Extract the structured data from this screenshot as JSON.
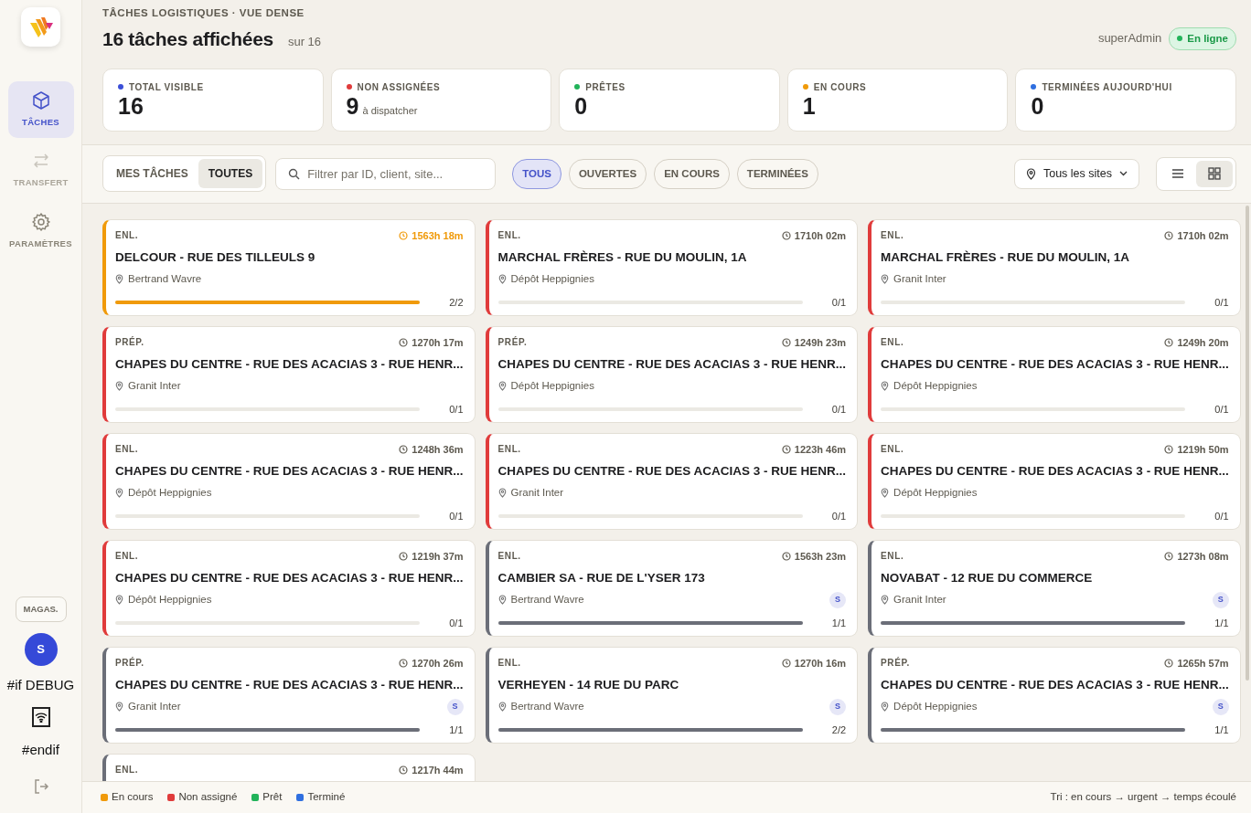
{
  "sidebar": {
    "items": [
      {
        "label": "TÂCHES",
        "selected": true,
        "disabled": false
      },
      {
        "label": "TRANSFERT",
        "selected": false,
        "disabled": true
      },
      {
        "label": "PARAMÈTRES",
        "selected": false,
        "disabled": false
      }
    ],
    "role_button": "MAGAS.",
    "avatar": "S",
    "debug_start": "#if DEBUG",
    "debug_end": "#endif"
  },
  "header": {
    "eyebrow": "TÂCHES LOGISTIQUES · VUE DENSE",
    "title": "16 tâches affichées",
    "subtitle": "sur 16",
    "user": "superAdmin",
    "status": "En ligne"
  },
  "stats": [
    {
      "label": "TOTAL VISIBLE",
      "value": "16",
      "color": "#3b4fd8"
    },
    {
      "label": "NON ASSIGNÉES",
      "value": "9",
      "note": "à dispatcher",
      "color": "#e03b3b"
    },
    {
      "label": "PRÊTES",
      "value": "0",
      "color": "#22b35a"
    },
    {
      "label": "EN COURS",
      "value": "1",
      "color": "#f09a0a"
    },
    {
      "label": "TERMINÉES AUJOURD'HUI",
      "value": "0",
      "color": "#2f6fe0"
    }
  ],
  "scope_tabs": [
    {
      "label": "MES TÂCHES",
      "selected": false
    },
    {
      "label": "TOUTES",
      "selected": true
    }
  ],
  "search": {
    "placeholder": "Filtrer par ID, client, site..."
  },
  "filters": [
    {
      "label": "TOUS",
      "selected": true
    },
    {
      "label": "OUVERTES",
      "selected": false
    },
    {
      "label": "EN COURS",
      "selected": false
    },
    {
      "label": "TERMINÉES",
      "selected": false
    }
  ],
  "site_select": "Tous les sites",
  "views": [
    {
      "selected": false
    },
    {
      "selected": true
    }
  ],
  "tasks": [
    {
      "type": "ENL.",
      "time": "1563h 18m",
      "title": "DELCOUR - RUE DES TILLEULS 9",
      "site": "Bertrand Wavre",
      "progress": "2/2",
      "level": 1,
      "kind": "active"
    },
    {
      "type": "ENL.",
      "time": "1710h 02m",
      "title": "MARCHAL FRÈRES - RUE DU MOULIN, 1A",
      "site": "Dépôt Heppignies",
      "progress": "0/1",
      "level": 0,
      "kind": "unassigned"
    },
    {
      "type": "ENL.",
      "time": "1710h 02m",
      "title": "MARCHAL FRÈRES - RUE DU MOULIN, 1A",
      "site": "Granit Inter",
      "progress": "0/1",
      "level": 0,
      "kind": "unassigned"
    },
    {
      "type": "PRÉP.",
      "time": "1270h 17m",
      "title": "CHAPES DU CENTRE - RUE DES ACACIAS 3 - RUE HENR...",
      "site": "Granit Inter",
      "progress": "0/1",
      "level": 0,
      "kind": "unassigned"
    },
    {
      "type": "PRÉP.",
      "time": "1249h 23m",
      "title": "CHAPES DU CENTRE - RUE DES ACACIAS 3 - RUE HENR...",
      "site": "Dépôt Heppignies",
      "progress": "0/1",
      "level": 0,
      "kind": "unassigned"
    },
    {
      "type": "ENL.",
      "time": "1249h 20m",
      "title": "CHAPES DU CENTRE - RUE DES ACACIAS 3 - RUE HENR...",
      "site": "Dépôt Heppignies",
      "progress": "0/1",
      "level": 0,
      "kind": "unassigned"
    },
    {
      "type": "ENL.",
      "time": "1248h 36m",
      "title": "CHAPES DU CENTRE - RUE DES ACACIAS 3 - RUE HENR...",
      "site": "Dépôt Heppignies",
      "progress": "0/1",
      "level": 0,
      "kind": "unassigned"
    },
    {
      "type": "ENL.",
      "time": "1223h 46m",
      "title": "CHAPES DU CENTRE - RUE DES ACACIAS 3 - RUE HENR...",
      "site": "Granit Inter",
      "progress": "0/1",
      "level": 0,
      "kind": "unassigned"
    },
    {
      "type": "ENL.",
      "time": "1219h 50m",
      "title": "CHAPES DU CENTRE - RUE DES ACACIAS 3 - RUE HENR...",
      "site": "Dépôt Heppignies",
      "progress": "0/1",
      "level": 0,
      "kind": "unassigned"
    },
    {
      "type": "ENL.",
      "time": "1219h 37m",
      "title": "CHAPES DU CENTRE - RUE DES ACACIAS 3 - RUE HENR...",
      "site": "Dépôt Heppignies",
      "progress": "0/1",
      "level": 0,
      "kind": "unassigned"
    },
    {
      "type": "ENL.",
      "time": "1563h 23m",
      "title": "CAMBIER SA - RUE DE L'YSER 173",
      "site": "Bertrand Wavre",
      "assignee": "S",
      "progress": "1/1",
      "level": 1,
      "kind": "assigned"
    },
    {
      "type": "ENL.",
      "time": "1273h 08m",
      "title": "NOVABAT - 12 RUE DU COMMERCE",
      "site": "Granit Inter",
      "assignee": "S",
      "progress": "1/1",
      "level": 1,
      "kind": "assigned"
    },
    {
      "type": "PRÉP.",
      "time": "1270h 26m",
      "title": "CHAPES DU CENTRE - RUE DES ACACIAS 3 - RUE HENR...",
      "site": "Granit Inter",
      "assignee": "S",
      "progress": "1/1",
      "level": 1,
      "kind": "assigned"
    },
    {
      "type": "ENL.",
      "time": "1270h 16m",
      "title": "VERHEYEN - 14 RUE DU PARC",
      "site": "Bertrand Wavre",
      "assignee": "S",
      "progress": "2/2",
      "level": 1,
      "kind": "assigned"
    },
    {
      "type": "PRÉP.",
      "time": "1265h 57m",
      "title": "CHAPES DU CENTRE - RUE DES ACACIAS 3 - RUE HENR...",
      "site": "Dépôt Heppignies",
      "assignee": "S",
      "progress": "1/1",
      "level": 1,
      "kind": "assigned"
    },
    {
      "type": "ENL.",
      "time": "1217h 44m",
      "kind": "assigned"
    }
  ],
  "legend": [
    {
      "label": "En cours",
      "color": "#f09a0a"
    },
    {
      "label": "Non assigné",
      "color": "#e03b3b"
    },
    {
      "label": "Prêt",
      "color": "#22b35a"
    },
    {
      "label": "Terminé",
      "color": "#2f6fe0"
    }
  ],
  "sort_note": "Tri : en cours → urgent → temps écoulé"
}
